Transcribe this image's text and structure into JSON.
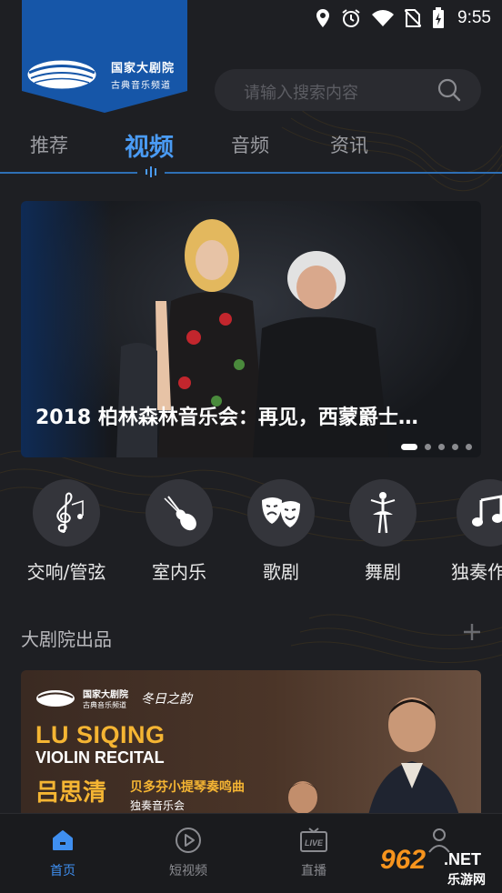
{
  "status_bar": {
    "time": "9:55",
    "icons": [
      "location-icon",
      "alarm-icon",
      "wifi-icon",
      "no-sim-icon",
      "battery-charging-icon"
    ]
  },
  "logo": {
    "name_cn": "国家大剧院",
    "sub_cn": "古典音乐频道"
  },
  "search": {
    "placeholder": "请输入搜索内容",
    "icon": "search-icon"
  },
  "tabs": [
    {
      "label": "推荐",
      "active": false
    },
    {
      "label": "视频",
      "active": true
    },
    {
      "label": "音频",
      "active": false
    },
    {
      "label": "资讯",
      "active": false
    }
  ],
  "banner": {
    "title": "2018  柏林森林音乐会：再见，西蒙爵士…",
    "slide_count": 5,
    "active_slide": 1
  },
  "categories": [
    {
      "label": "交响/管弦",
      "icon": "treble-clef-icon"
    },
    {
      "label": "室内乐",
      "icon": "violin-icon"
    },
    {
      "label": "歌剧",
      "icon": "theater-masks-icon"
    },
    {
      "label": "舞剧",
      "icon": "ballerina-icon"
    },
    {
      "label": "独奏作",
      "icon": "music-notes-icon"
    }
  ],
  "section": {
    "title": "大剧院出品",
    "action_icon": "plus-icon"
  },
  "promo": {
    "brand_cn": "国家大剧院",
    "brand_sub": "古典音乐频道",
    "series": "冬日之韵",
    "title_en_1": "LU SIQING",
    "title_en_2": "VIOLIN RECITAL",
    "name_cn": "吕思清",
    "subtitle_cn": "贝多芬小提琴奏鸣曲",
    "event_cn": "独奏音乐会"
  },
  "bottom_nav": [
    {
      "label": "首页",
      "icon": "home-icon",
      "active": true
    },
    {
      "label": "短视频",
      "icon": "play-circle-icon",
      "active": false
    },
    {
      "label": "直播",
      "icon": "live-tv-icon",
      "active": false
    },
    {
      "label": "",
      "icon": "profile-icon",
      "active": false
    }
  ],
  "watermark": {
    "number": "962",
    "suffix": ".NET",
    "text_cn": "乐游网"
  },
  "colors": {
    "background": "#1e1f23",
    "accent": "#4a9bf4",
    "logo_blue": "#1656a8",
    "promo_gold": "#f5b533"
  }
}
